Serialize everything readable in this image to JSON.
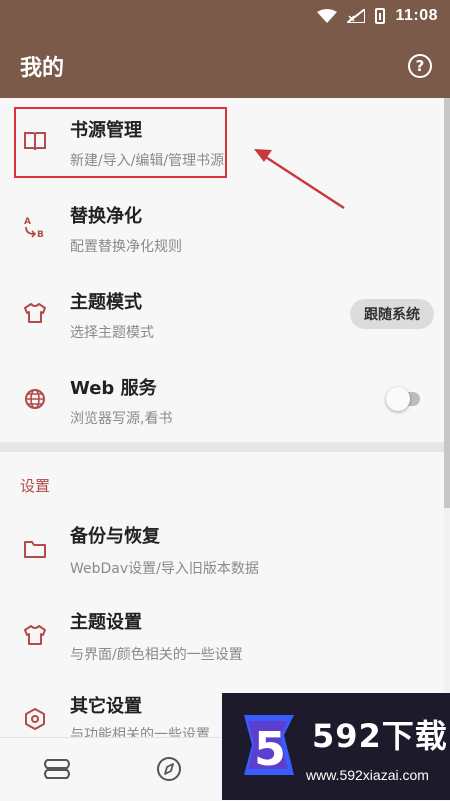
{
  "status_bar": {
    "time": "11:08"
  },
  "app_bar": {
    "title": "我的",
    "help_icon": "question-circle-icon"
  },
  "main_items": [
    {
      "label": "书源管理",
      "desc": "新建/导入/编辑/管理书源",
      "icon": "book-icon"
    },
    {
      "label": "替换净化",
      "desc": "配置替换净化规则",
      "icon": "replace-ab-icon"
    },
    {
      "label": "主题模式",
      "desc": "选择主题模式",
      "icon": "shirt-icon",
      "action": "跟随系统"
    },
    {
      "label": "Web 服务",
      "desc": "浏览器写源,看书",
      "icon": "globe-icon",
      "toggle_on": false
    }
  ],
  "settings": {
    "header": "设置",
    "items": [
      {
        "label": "备份与恢复",
        "desc": "WebDav设置/导入旧版本数据",
        "icon": "folder-icon"
      },
      {
        "label": "主题设置",
        "desc": "与界面/颜色相关的一些设置",
        "icon": "shirt-icon"
      },
      {
        "label": "其它设置",
        "desc": "与功能相关的一些设置",
        "icon": "settings-hex-icon"
      }
    ]
  },
  "bottom_nav": {
    "items": [
      "bookshelf-icon",
      "compass-icon"
    ]
  },
  "watermark": {
    "title": "592下载",
    "url": "www.592xiazai.com",
    "logo_glyph": "5"
  },
  "colors": {
    "primary": "#7b5a4a",
    "accent": "#b44a4a",
    "highlight": "#e0323d"
  }
}
